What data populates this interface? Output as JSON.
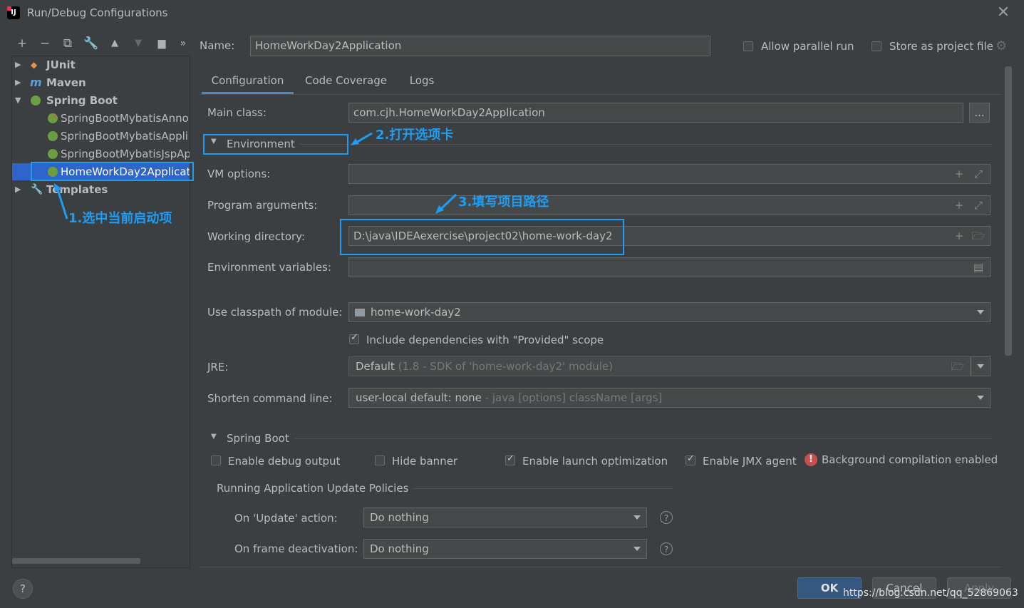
{
  "window": {
    "title": "Run/Debug Configurations",
    "app_icon_text": "IJ"
  },
  "toolbar": {
    "icons": [
      "plus-icon",
      "minus-icon",
      "copy-icon",
      "wrench-icon",
      "arrow-up-icon",
      "arrow-down-icon",
      "folder-add-icon",
      "more-icon"
    ]
  },
  "tree": {
    "items": [
      {
        "label": "JUnit",
        "expanded": false
      },
      {
        "label": "Maven",
        "expanded": false
      },
      {
        "label": "Spring Boot",
        "expanded": true
      },
      {
        "label": "SpringBootMybatisAnno"
      },
      {
        "label": "SpringBootMybatisAppli"
      },
      {
        "label": "SpringBootMybatisJspAp"
      },
      {
        "label": "HomeWorkDay2Applicat",
        "selected": true
      },
      {
        "label": "Templates",
        "expanded": false
      }
    ]
  },
  "header": {
    "name_label": "Name:",
    "name_value": "HomeWorkDay2Application",
    "allow_parallel": "Allow parallel run",
    "store_project": "Store as project file"
  },
  "tabs": [
    "Configuration",
    "Code Coverage",
    "Logs"
  ],
  "form": {
    "main_class_label": "Main class:",
    "main_class_value": "com.cjh.HomeWorkDay2Application",
    "browse": "...",
    "environment_label": "Environment",
    "vm_options_label": "VM options:",
    "program_args_label": "Program arguments:",
    "working_dir_label": "Working directory:",
    "working_dir_value": "D:\\java\\IDEAexercise\\project02\\home-work-day2",
    "env_vars_label": "Environment variables:",
    "classpath_label": "Use classpath of module:",
    "classpath_value": "home-work-day2",
    "include_deps": "Include dependencies with \"Provided\" scope",
    "jre_label": "JRE:",
    "jre_value": "Default",
    "jre_muted": "(1.8 - SDK of 'home-work-day2' module)",
    "shorten_label": "Shorten command line:",
    "shorten_value": "user-local default: none",
    "shorten_muted": "- java [options] className [args]"
  },
  "spring_boot": {
    "section_label": "Spring Boot",
    "enable_debug": "Enable debug output",
    "hide_banner": "Hide banner",
    "enable_launch": "Enable launch optimization",
    "enable_jmx": "Enable JMX agent",
    "bg_compilation": "Background compilation enabled",
    "policies_label": "Running Application Update Policies",
    "on_update_label": "On 'Update' action:",
    "on_update_value": "Do nothing",
    "on_frame_label": "On frame deactivation:",
    "on_frame_value": "Do nothing"
  },
  "annotations": {
    "step1": "1.选中当前启动项",
    "step2": "2.打开选项卡",
    "step3": "3.填写项目路径"
  },
  "buttons": {
    "ok": "OK",
    "cancel": "Cancel",
    "apply": "Apply",
    "help": "?"
  },
  "watermark": "https://blog.csdn.net/qq_52869063",
  "colors": {
    "accent": "#1e9df2",
    "selection": "#2f65ca",
    "background": "#3c3f41"
  }
}
